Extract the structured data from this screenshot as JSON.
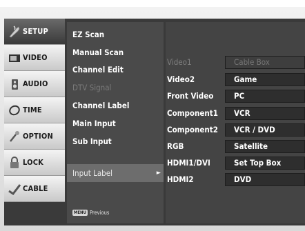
{
  "tabs": [
    {
      "label": "SETUP",
      "icon": "setup-icon"
    },
    {
      "label": "VIDEO",
      "icon": "video-icon"
    },
    {
      "label": "AUDIO",
      "icon": "audio-icon"
    },
    {
      "label": "TIME",
      "icon": "time-icon"
    },
    {
      "label": "OPTION",
      "icon": "option-icon"
    },
    {
      "label": "LOCK",
      "icon": "lock-icon"
    },
    {
      "label": "CABLE",
      "icon": "cable-icon"
    }
  ],
  "menu": {
    "items": [
      {
        "label": "EZ Scan"
      },
      {
        "label": "Manual Scan"
      },
      {
        "label": "Channel Edit"
      },
      {
        "label": "DTV Signal",
        "disabled": true
      },
      {
        "label": "Channel Label"
      },
      {
        "label": "Main Input"
      },
      {
        "label": "Sub Input"
      }
    ],
    "selected": {
      "label": "Input Label",
      "arrow": "►"
    },
    "footer": {
      "button": "MENU",
      "label": "Previous"
    }
  },
  "submenu": {
    "rows": [
      {
        "label": "Video1",
        "value": "Cable Box",
        "disabled": true
      },
      {
        "label": "Video2",
        "value": "Game"
      },
      {
        "label": "Front Video",
        "value": "PC"
      },
      {
        "label": "Component1",
        "value": "VCR"
      },
      {
        "label": "Component2",
        "value": "VCR / DVD"
      },
      {
        "label": "RGB",
        "value": "Satellite"
      },
      {
        "label": "HDMI1/DVI",
        "value": "Set Top Box"
      },
      {
        "label": "HDMI2",
        "value": "DVD"
      }
    ]
  }
}
